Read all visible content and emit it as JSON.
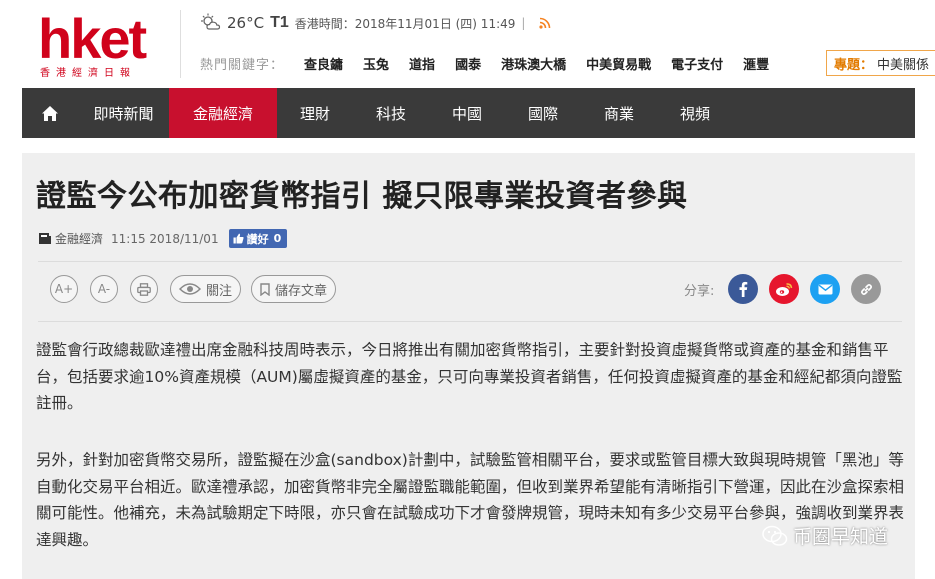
{
  "brand": {
    "name": "hket",
    "tagline": "香港經濟日報",
    "color": "#d0021b"
  },
  "weather": {
    "icon": "cloudy-sun-icon",
    "temperature": "26°C",
    "signal": "T1",
    "time_label": "香港時間：2018年11月01日 (四) 11:49",
    "rss_icon": "rss-icon"
  },
  "hot_keywords": {
    "label": "熱門關鍵字：",
    "items": [
      "查良鏞",
      "玉兔",
      "道指",
      "國泰",
      "港珠澳大橋",
      "中美貿易戰",
      "電子支付",
      "滙豐"
    ]
  },
  "topic": {
    "label": "專題：",
    "value": "中美關係"
  },
  "nav": {
    "home_icon": "home-icon",
    "items": [
      {
        "label": "即時新聞"
      },
      {
        "label": "金融經濟"
      },
      {
        "label": "理財"
      },
      {
        "label": "科技"
      },
      {
        "label": "中國"
      },
      {
        "label": "國際"
      },
      {
        "label": "商業"
      },
      {
        "label": "視頻"
      }
    ],
    "active_index": 1
  },
  "article": {
    "title": "證監今公布加密貨幣指引 擬只限專業投資者參與",
    "category": "金融經濟",
    "timestamp": "11:15 2018/11/01",
    "like_label": "讚好",
    "like_count": "0",
    "tools": {
      "font_increase": "A+",
      "font_decrease": "A-",
      "follow_label": "關注",
      "save_label": "儲存文章"
    },
    "share_label": "分享:",
    "share_colors": {
      "facebook": "#3b5998",
      "weibo": "#e6162d",
      "email": "#1da1f2",
      "link": "#999999"
    },
    "paragraphs": [
      "證監會行政總裁歐達禮出席金融科技周時表示，今日將推出有關加密貨幣指引，主要針對投資虛擬貨幣或資產的基金和銷售平台，包括要求逾10%資產規模（AUM)屬虛擬資產的基金，只可向專業投資者銷售，任何投資虛擬資產的基金和經紀都須向證監註冊。",
      "另外，針對加密貨幣交易所，證監擬在沙盒(sandbox)計劃中，試驗監管相關平台，要求或監管目標大致與現時規管「黑池」等自動化交易平台相近。歐達禮承認，加密貨幣非完全屬證監職能範圍，但收到業界希望能有清晰指引下營運，因此在沙盒探索相關可能性。他補充，未為試驗期定下時限，亦只會在試驗成功下才會發牌規管，現時未知有多少交易平台參與，強調收到業界表達興趣。"
    ]
  },
  "watermark": "币圈早知道"
}
